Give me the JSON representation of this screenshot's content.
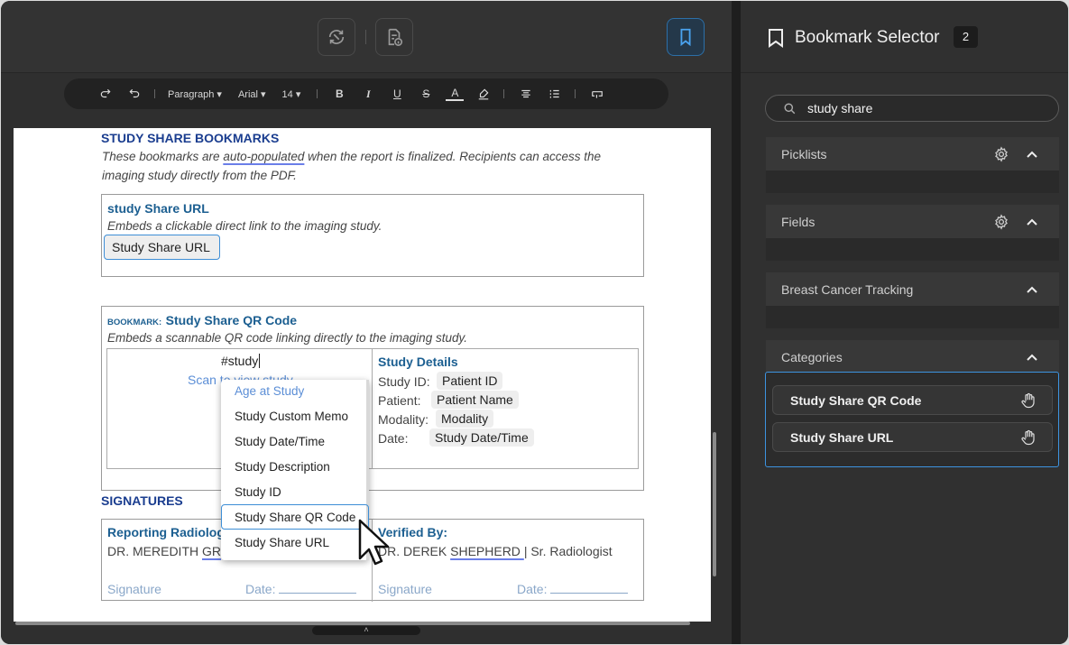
{
  "toolbar": {
    "paragraph": "Paragraph ▾",
    "font": "Arial ▾",
    "size": "14 ▾"
  },
  "doc": {
    "section_title": "STUDY SHARE BOOKMARKS",
    "intro_pre": "These bookmarks are ",
    "intro_link": "auto-populated",
    "intro_post": " when the report is finalized. Recipients can access the",
    "intro_line2": "imaging study directly from the PDF.",
    "url_box": {
      "title": "study Share URL",
      "desc": "Embeds a clickable direct link to the imaging study.",
      "chip": "Study Share URL"
    },
    "qr_box": {
      "prefix": "BOOKMARK:",
      "title": "Study Share QR Code",
      "desc": "Embeds a scannable QR code linking directly to the imaging study.",
      "typed": "#study",
      "scan": "Scan to view study"
    },
    "details": {
      "title": "Study Details",
      "rows": [
        {
          "label": "Study ID:",
          "value": "Patient ID"
        },
        {
          "label": "Patient:",
          "value": "Patient Name"
        },
        {
          "label": "Modality:",
          "value": "Modality"
        },
        {
          "label": "Date:",
          "value": "Study Date/Time"
        }
      ]
    },
    "signatures": {
      "title": "SIGNATURES",
      "left_title": "Reporting Radiologist",
      "left_name_pre": "DR. MEREDITH ",
      "left_name_u": "GR",
      "right_title": "Verified By:",
      "right_name_pre": "DR. DEREK ",
      "right_name_u": "SHEPHERD ",
      "right_name_post": " |  Sr. Radiologist",
      "sig_label": "Signature",
      "date_label": "Date:"
    }
  },
  "dropdown": {
    "items": [
      "Age at Study",
      "Study Custom Memo",
      "Study Date/Time",
      "Study Description",
      "Study ID",
      "Study Share QR Code",
      "Study Share URL"
    ]
  },
  "panel": {
    "title": "Bookmark Selector",
    "count": "2",
    "search_value": "study share",
    "sections": [
      "Picklists",
      "Fields",
      "Breast Cancer Tracking",
      "Categories"
    ],
    "categories": [
      "Study Share QR Code",
      "Study Share URL"
    ]
  }
}
